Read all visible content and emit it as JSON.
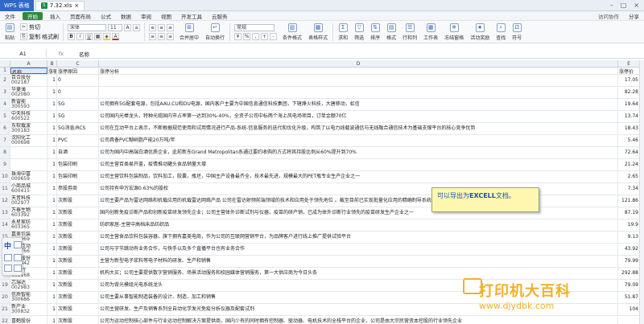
{
  "title_bar": {
    "app_tab": "WPS 表格",
    "doc_tab": "7.32.xls",
    "doc_icon": "xls-file-icon"
  },
  "menu": {
    "file": "文件",
    "items": [
      "开始",
      "插入",
      "页面布局",
      "公式",
      "数据",
      "审阅",
      "视图",
      "开发工具",
      "云服务"
    ],
    "active": "开始",
    "right": [
      "访问协作",
      "分享"
    ]
  },
  "toolbar": {
    "paste": "粘贴",
    "cut": "剪切",
    "copy": "复制",
    "format_painter": "格式刷",
    "font_name": "宋体",
    "font_size": "11",
    "merge_center": "合并居中",
    "wrap": "自动换行",
    "number_format": "常规",
    "conditional_format": "条件格式",
    "table_style": "表格样式",
    "sum": "求和",
    "filter": "筛选",
    "sort": "排序",
    "format": "格式",
    "row_col": "行和列",
    "worksheet": "工作表",
    "freeze": "冻结窗格",
    "activity": "活动奖励",
    "find": "查找",
    "symbol": "符号"
  },
  "formula_bar": {
    "name_box": "A1",
    "fx": "fx",
    "content": "名称"
  },
  "columns": [
    "A",
    "B",
    "C",
    "D",
    "E",
    "F"
  ],
  "header_row": {
    "a": "名称",
    "b": "涨幅",
    "c": "涨停原因",
    "d": "涨停分析",
    "e": "涨停价",
    "f": "财"
  },
  "rows": [
    {
      "n": "2",
      "name": "百合股份",
      "code": "002187",
      "b": "1",
      "c": "0",
      "d": "",
      "e": "17.05",
      "f": "0"
    },
    {
      "n": "3",
      "name": "华菱薄",
      "code": "002080",
      "b": "1",
      "c": "0",
      "d": "",
      "e": "82.28",
      "f": "1"
    },
    {
      "n": "4",
      "name": "新雷能",
      "code": "300593",
      "b": "1",
      "c": "5G",
      "d": "公司拥有5G配套电源，包括AAU,CU和DU电源，国内客户主要为中国信息通信科技集团，下辖烽火科技，大唐移动，虹信",
      "e": "19.64",
      "f": "0"
    },
    {
      "n": "5",
      "name": "中天科技",
      "code": "600522",
      "b": "1",
      "c": "5G",
      "d": "公司国内光棒龙头，特种光缆国内市占率第一达到30%-40%，全资子公司中标两个海上风电场项目，订单金额70亿",
      "e": "13.74",
      "f": "0"
    },
    {
      "n": "6",
      "name": "东软载波",
      "code": "300183",
      "b": "1",
      "c": "5G消息/RCS",
      "d": "公司在互动平台上表示，不断根据规范使用和试用情况进行产品-系统-信息服务的迭代和优化升级，构筑了以电力线载波通信与无线融合通信技术为基础支撑平台的核心竞争优势",
      "e": "18.43",
      "f": "0"
    },
    {
      "n": "7",
      "name": "沈阳化工",
      "code": "000698",
      "b": "1",
      "c": "PVC",
      "d": "公司具备PVC糊树脂产能20万吨/年",
      "e": "5.46",
      "f": "0"
    },
    {
      "n": "8",
      "name": "",
      "code": "",
      "b": "1",
      "c": "自酒",
      "d": "公司为国内中高端白酒优质企业，此前新东Grand Metropolitan系通过要约收购的方式将其持股比例从60%提升到70%",
      "e": "72.64",
      "f": "1"
    },
    {
      "n": "9",
      "name": "",
      "code": "",
      "b": "1",
      "c": "包装印刷",
      "d": "公司主营百类易开盖，疫情推动罐头食品销量大增",
      "e": "21.24",
      "f": "0"
    },
    {
      "n": "10",
      "name": "珠海中富",
      "code": "000659",
      "b": "1",
      "c": "包装印刷",
      "d": "公司主营饮料包装制品，饮料加工，胶囊，瓶坯，中国主产设备最齐全，技术最先进，规模最大的PET瓶专业生产企业之一",
      "e": "2.65",
      "f": "0"
    },
    {
      "n": "11",
      "name": "小商品城",
      "code": "600415",
      "b": "1",
      "c": "参股券商",
      "d": "公司持有申万宏源0.63%的股权",
      "e": "7.34",
      "f": "0"
    },
    {
      "n": "12",
      "name": "天音科技",
      "code": "002977",
      "b": "1",
      "c": "次新股",
      "d": "公司主要产品为雷达网络和机载应用的机载雷达网络产品 公司在雷达射频前端领域的技术和应用处于领先地位 。截至目前已实现批量化应用的精确制导系统等",
      "e": "121.86",
      "f": "0"
    },
    {
      "n": "13",
      "name": "万泰生物",
      "code": "603392",
      "b": "1",
      "c": "次新股",
      "d": "国内创新免疫诊断产品和创新疫苗研发领先企业；公司主营体外诊断试剂与仪器，疫苗的研产销，已成为体外诊断行业领先的疫苗研发生产企业之一",
      "e": "87.19",
      "f": "0"
    },
    {
      "n": "14",
      "name": "永星家纺",
      "code": "603365",
      "b": "1",
      "c": "次新股",
      "d": "纺织家居-主营中高档床品纺织品",
      "e": "19.9",
      "f": "0"
    },
    {
      "n": "15",
      "name": "嘉美包装",
      "code": "002969",
      "b": "1",
      "c": "次新股",
      "d": "公司主营食品饮料包装容器，旗下拥有嘉美电商，作为公司的互联网营销平台，为品牌客户进行线上推广提供试验平台",
      "e": "9.13",
      "f": "0"
    },
    {
      "n": "16",
      "name": "每日互动",
      "code": "300766",
      "b": "1",
      "c": "次新股",
      "d": "公司与字节跳动有业务合作，与快手以及多个直播平台也有业务合作",
      "e": "43.92",
      "f": "0"
    },
    {
      "n": "17",
      "name": "帝科股份",
      "code": "300842",
      "b": "1",
      "c": "次新股",
      "d": "主营为新型电子浆料等电子材料的研发、生产和销售",
      "e": "79.99",
      "f": "0"
    },
    {
      "n": "18",
      "name": "三人行",
      "code": "605168",
      "b": "1",
      "c": "次新股",
      "d": "机构大买；公司主要提供数字营销服务、场景活动服务和校园媒体营销服务，第一大供应商为今日头条",
      "e": "292.88",
      "f": "0"
    },
    {
      "n": "19",
      "name": "芯瑞达",
      "code": "002983",
      "b": "1",
      "c": "次新股",
      "d": "公司为背光模组光电系统龙头",
      "e": "79.09",
      "f": "0"
    },
    {
      "n": "20",
      "name": "信质智能",
      "code": "300686",
      "b": "1",
      "c": "次新股",
      "d": "公司主要从事智能制造装备的设计、制造、加工和销售",
      "e": "51.87",
      "f": "0"
    },
    {
      "n": "21",
      "name": "新产业",
      "code": "300832",
      "b": "1",
      "c": "次新股",
      "d": "公司主营研发、生产及销售系列全自动化学发光免疫分析仪器及配套试剂",
      "e": "104",
      "f": "0"
    },
    {
      "n": "22",
      "name": "喜鹤股份",
      "code": "",
      "b": "1",
      "c": "次新股",
      "d": "公司为运动控制核心部件与行业运动控制解决方案提供商，国内少有的同时拥有控制器、驱动器、电机技术的全栈平台的企业，公司是由大宗民营资本控股的行业领先企业",
      "e": "",
      "f": ""
    }
  ],
  "callout": {
    "prefix": "可以导出为",
    "bold": "EXCELL",
    "suffix": "文档。"
  },
  "floating_widget": {
    "label": "中"
  },
  "watermark": {
    "title": "打印机大百科",
    "url": "www.djydbk.com"
  }
}
